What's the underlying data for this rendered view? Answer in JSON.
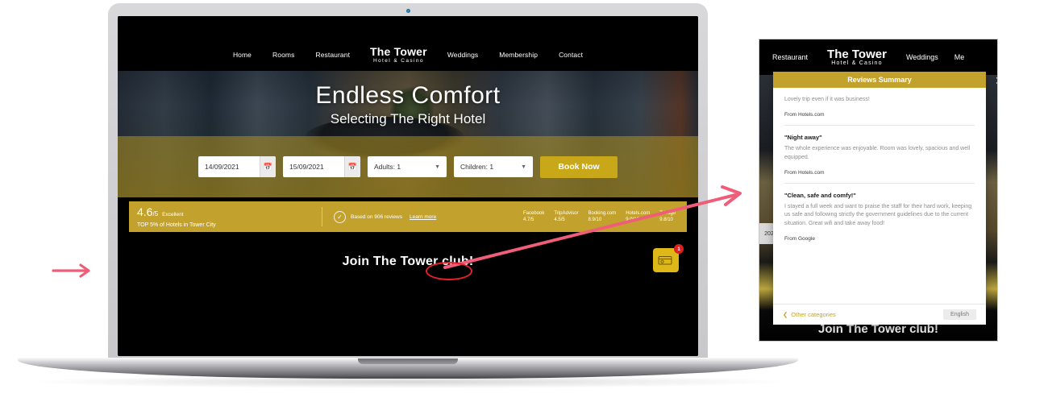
{
  "site": {
    "nav": [
      {
        "label": "Home"
      },
      {
        "label": "Rooms"
      },
      {
        "label": "Restaurant"
      },
      {
        "label": "Weddings"
      },
      {
        "label": "Membership"
      },
      {
        "label": "Contact"
      }
    ],
    "brand": {
      "name": "The Tower",
      "tagline": "Hotel & Casino"
    },
    "hero": {
      "title": "Endless Comfort",
      "subtitle": "Selecting The Right Hotel"
    },
    "booking": {
      "checkin": "14/09/2021",
      "checkout": "15/09/2021",
      "adults": "Adults: 1",
      "children": "Children: 1",
      "book_label": "Book Now",
      "calendar_icon": "calendar-icon",
      "caret_icon": "chevron-down-icon"
    },
    "reviews_strip": {
      "score": "4.6",
      "score_denominator": "/5",
      "score_label": "Excellent",
      "rank_text": "TOP 5% of Hotels in Tower City",
      "check_icon": "check-circle-icon",
      "based_on": "Based on 906 reviews",
      "learn_more": "Learn more",
      "sites": [
        {
          "name": "Facebook",
          "score": "4.7/5"
        },
        {
          "name": "TripAdvisor",
          "score": "4.5/5"
        },
        {
          "name": "Booking.com",
          "score": "8.9/10"
        },
        {
          "name": "Hotels.com",
          "score": "9.0/10"
        },
        {
          "name": "Trivago",
          "score": "9.8/10"
        }
      ]
    },
    "club": {
      "title": "Join The Tower club!",
      "badge_count": "1",
      "card_icon": "membership-card-icon"
    }
  },
  "mobile": {
    "nav": [
      {
        "label": "Restaurant"
      },
      {
        "label": "Weddings"
      },
      {
        "label": "Me"
      }
    ],
    "brand": {
      "name": "The Tower",
      "tagline": "Hotel & Casino"
    },
    "date_fragment": "202",
    "club_title": "Join The Tower club!",
    "modal": {
      "title": "Reviews Summary",
      "close_icon": "close-icon",
      "reviews": [
        {
          "title": "",
          "text": "Lovely trip even if it was business!",
          "from": "From Hotels.com"
        },
        {
          "title": "\"Night away\"",
          "text": "The whole experience was enjoyable. Room was lovely, spacious and well equipped.",
          "from": "From Hotels.com"
        },
        {
          "title": "\"Clean, safe and comfy!\"",
          "text": "I stayed a full week and want to praise the staff for their hard work, keeping us safe and following strictly the government guidelines due to the current situation. Great wifi and take away food!",
          "from": "From Google"
        }
      ],
      "footer": {
        "back_label": "Other categories",
        "back_icon": "chevron-left-icon",
        "language": "English"
      }
    }
  },
  "annotations": {
    "arrow_color": "#ef5d79",
    "highlight_color": "#e8202a",
    "left_arrow_icon": "arrow-right-icon",
    "diagonal_arrow_icon": "arrow-pointer-icon",
    "highlight_ellipse_icon": "ellipse-highlight-icon"
  },
  "device": {
    "camera_icon": "webcam-dot-icon"
  }
}
